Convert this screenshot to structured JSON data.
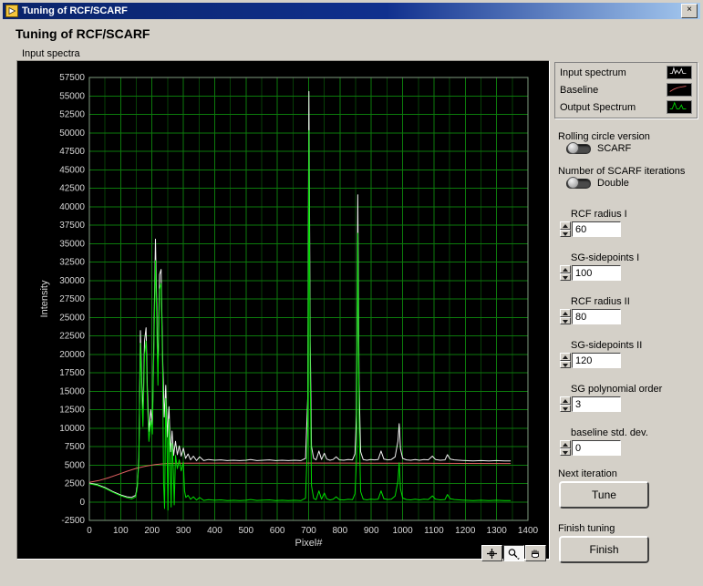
{
  "window": {
    "title": "Tuning of RCF/SCARF",
    "close_glyph": "×"
  },
  "heading": "Tuning of RCF/SCARF",
  "legend": {
    "items": [
      {
        "label": "Input spectrum",
        "color": "#f2f2f2"
      },
      {
        "label": "Baseline",
        "color": "#e06060"
      },
      {
        "label": "Output Spectrum",
        "color": "#00dc00"
      }
    ]
  },
  "controls": {
    "rolling": {
      "label": "Rolling circle version",
      "value": "SCARF"
    },
    "iterations": {
      "label": "Number of SCARF iterations",
      "value": "Double"
    },
    "numerics": [
      {
        "label": "RCF radius I",
        "value": "60"
      },
      {
        "label": "SG-sidepoints I",
        "value": "100"
      },
      {
        "label": "RCF radius II",
        "value": "80"
      },
      {
        "label": "SG-sidepoints II",
        "value": "120"
      },
      {
        "label": "SG polynomial order",
        "value": "3"
      },
      {
        "label": "baseline std. dev.",
        "value": "0"
      }
    ],
    "next_iteration": {
      "label": "Next iteration",
      "button": "Tune"
    },
    "finish": {
      "label": "Finish tuning",
      "button": "Finish"
    }
  },
  "palette": {
    "tools": [
      "cursor-tool",
      "zoom-tool",
      "pan-tool"
    ],
    "active": "zoom-tool"
  },
  "chart_data": {
    "type": "line",
    "title": "Input spectra",
    "xlabel": "Pixel#",
    "ylabel": "Intensity",
    "xlim": [
      0,
      1400
    ],
    "ylim": [
      -2500,
      57500
    ],
    "x_ticks": [
      0,
      100,
      200,
      300,
      400,
      500,
      600,
      700,
      800,
      900,
      1000,
      1100,
      1200,
      1300,
      1400
    ],
    "y_ticks": [
      57500,
      55000,
      52500,
      50000,
      47500,
      45000,
      42500,
      40000,
      37500,
      35000,
      32500,
      30000,
      27500,
      25000,
      22500,
      20000,
      17500,
      15000,
      12500,
      10000,
      7500,
      5000,
      2500,
      0,
      -2500
    ],
    "x_minor_step": 50,
    "bg_color": "#000000",
    "grid_major_color": "#0c7a0c",
    "grid_minor_color": "#063f06",
    "frame_color": "#7f9b7f",
    "tick_text_color": "#d8d8d8",
    "legend_position": "top-right-outside",
    "grid": true,
    "series": [
      {
        "name": "Baseline",
        "color": "#e06060",
        "points": [
          [
            0,
            2650
          ],
          [
            30,
            2900
          ],
          [
            60,
            3250
          ],
          [
            90,
            3700
          ],
          [
            120,
            4150
          ],
          [
            150,
            4550
          ],
          [
            180,
            4850
          ],
          [
            210,
            5050
          ],
          [
            240,
            5180
          ],
          [
            270,
            5230
          ],
          [
            300,
            5250
          ],
          [
            450,
            5260
          ],
          [
            600,
            5260
          ],
          [
            750,
            5260
          ],
          [
            900,
            5250
          ],
          [
            1050,
            5240
          ],
          [
            1200,
            5220
          ],
          [
            1345,
            5200
          ]
        ]
      },
      {
        "name": "Input spectrum",
        "color": "#f2f2f2",
        "points": [
          [
            0,
            2550
          ],
          [
            25,
            2350
          ],
          [
            50,
            1950
          ],
          [
            75,
            1400
          ],
          [
            100,
            950
          ],
          [
            120,
            700
          ],
          [
            135,
            620
          ],
          [
            148,
            900
          ],
          [
            153,
            2200
          ],
          [
            158,
            6000
          ],
          [
            163,
            23200
          ],
          [
            167,
            16500
          ],
          [
            171,
            11500
          ],
          [
            176,
            21800
          ],
          [
            181,
            23600
          ],
          [
            185,
            15500
          ],
          [
            190,
            9500
          ],
          [
            196,
            12500
          ],
          [
            201,
            10500
          ],
          [
            206,
            22500
          ],
          [
            211,
            35600
          ],
          [
            215,
            26500
          ],
          [
            219,
            17500
          ],
          [
            224,
            30800
          ],
          [
            229,
            31500
          ],
          [
            234,
            19500
          ],
          [
            239,
            11500
          ],
          [
            244,
            15800
          ],
          [
            249,
            8800
          ],
          [
            254,
            12900
          ],
          [
            259,
            6800
          ],
          [
            264,
            9600
          ],
          [
            269,
            6300
          ],
          [
            275,
            8200
          ],
          [
            281,
            6400
          ],
          [
            287,
            7600
          ],
          [
            293,
            6200
          ],
          [
            300,
            7300
          ],
          [
            307,
            5900
          ],
          [
            315,
            6500
          ],
          [
            323,
            5700
          ],
          [
            332,
            6200
          ],
          [
            342,
            5600
          ],
          [
            352,
            6100
          ],
          [
            365,
            5600
          ],
          [
            380,
            5750
          ],
          [
            400,
            5650
          ],
          [
            420,
            5700
          ],
          [
            440,
            5600
          ],
          [
            460,
            5650
          ],
          [
            480,
            5600
          ],
          [
            500,
            5650
          ],
          [
            515,
            5750
          ],
          [
            535,
            5600
          ],
          [
            555,
            5650
          ],
          [
            575,
            5700
          ],
          [
            595,
            5600
          ],
          [
            615,
            5650
          ],
          [
            635,
            5600
          ],
          [
            655,
            5650
          ],
          [
            675,
            5600
          ],
          [
            690,
            5900
          ],
          [
            697,
            14000
          ],
          [
            701,
            55600
          ],
          [
            705,
            22000
          ],
          [
            709,
            7500
          ],
          [
            716,
            5900
          ],
          [
            724,
            5700
          ],
          [
            733,
            6900
          ],
          [
            741,
            5750
          ],
          [
            750,
            6600
          ],
          [
            758,
            5800
          ],
          [
            768,
            5650
          ],
          [
            778,
            5750
          ],
          [
            788,
            6100
          ],
          [
            798,
            5700
          ],
          [
            812,
            5650
          ],
          [
            826,
            5750
          ],
          [
            840,
            5700
          ],
          [
            848,
            6500
          ],
          [
            853,
            12000
          ],
          [
            857,
            41600
          ],
          [
            861,
            16000
          ],
          [
            866,
            6800
          ],
          [
            874,
            5750
          ],
          [
            886,
            5650
          ],
          [
            898,
            5750
          ],
          [
            910,
            5700
          ],
          [
            922,
            5750
          ],
          [
            931,
            6900
          ],
          [
            940,
            5800
          ],
          [
            952,
            5700
          ],
          [
            964,
            5750
          ],
          [
            976,
            6100
          ],
          [
            985,
            8200
          ],
          [
            989,
            10600
          ],
          [
            993,
            7200
          ],
          [
            1000,
            5900
          ],
          [
            1012,
            5700
          ],
          [
            1026,
            5650
          ],
          [
            1040,
            5750
          ],
          [
            1054,
            5650
          ],
          [
            1068,
            5750
          ],
          [
            1082,
            5700
          ],
          [
            1095,
            6200
          ],
          [
            1105,
            5750
          ],
          [
            1120,
            5650
          ],
          [
            1135,
            5700
          ],
          [
            1143,
            6400
          ],
          [
            1152,
            5800
          ],
          [
            1165,
            5700
          ],
          [
            1180,
            5650
          ],
          [
            1200,
            5600
          ],
          [
            1225,
            5550
          ],
          [
            1250,
            5600
          ],
          [
            1275,
            5550
          ],
          [
            1300,
            5600
          ],
          [
            1325,
            5550
          ],
          [
            1345,
            5550
          ]
        ]
      },
      {
        "name": "Output Spectrum",
        "color": "#00dc00",
        "points": [
          [
            0,
            2450
          ],
          [
            25,
            2250
          ],
          [
            50,
            1850
          ],
          [
            75,
            1300
          ],
          [
            100,
            850
          ],
          [
            120,
            560
          ],
          [
            135,
            400
          ],
          [
            148,
            680
          ],
          [
            153,
            1900
          ],
          [
            158,
            5400
          ],
          [
            163,
            21500
          ],
          [
            167,
            15000
          ],
          [
            171,
            10200
          ],
          [
            176,
            20000
          ],
          [
            181,
            21800
          ],
          [
            185,
            13800
          ],
          [
            190,
            8200
          ],
          [
            196,
            11000
          ],
          [
            201,
            9200
          ],
          [
            206,
            20800
          ],
          [
            211,
            32700
          ],
          [
            215,
            24500
          ],
          [
            219,
            15800
          ],
          [
            224,
            28800
          ],
          [
            229,
            29600
          ],
          [
            234,
            17800
          ],
          [
            237,
            2600
          ],
          [
            240,
            -900
          ],
          [
            244,
            14000
          ],
          [
            248,
            7200
          ],
          [
            251,
            -1100
          ],
          [
            254,
            11200
          ],
          [
            258,
            5200
          ],
          [
            261,
            -700
          ],
          [
            264,
            7900
          ],
          [
            268,
            4400
          ],
          [
            271,
            -400
          ],
          [
            275,
            6300
          ],
          [
            281,
            4500
          ],
          [
            287,
            5700
          ],
          [
            293,
            4200
          ],
          [
            300,
            5400
          ],
          [
            304,
            1500
          ],
          [
            308,
            600
          ],
          [
            315,
            900
          ],
          [
            323,
            350
          ],
          [
            332,
            700
          ],
          [
            342,
            250
          ],
          [
            352,
            600
          ],
          [
            365,
            200
          ],
          [
            380,
            300
          ],
          [
            400,
            230
          ],
          [
            420,
            280
          ],
          [
            440,
            180
          ],
          [
            460,
            230
          ],
          [
            480,
            180
          ],
          [
            500,
            230
          ],
          [
            515,
            330
          ],
          [
            535,
            200
          ],
          [
            555,
            240
          ],
          [
            575,
            280
          ],
          [
            595,
            180
          ],
          [
            615,
            230
          ],
          [
            635,
            180
          ],
          [
            655,
            230
          ],
          [
            675,
            180
          ],
          [
            690,
            500
          ],
          [
            697,
            9000
          ],
          [
            701,
            50300
          ],
          [
            705,
            17000
          ],
          [
            709,
            2200
          ],
          [
            716,
            480
          ],
          [
            724,
            300
          ],
          [
            733,
            1500
          ],
          [
            741,
            380
          ],
          [
            750,
            1200
          ],
          [
            758,
            420
          ],
          [
            768,
            270
          ],
          [
            778,
            350
          ],
          [
            788,
            700
          ],
          [
            798,
            320
          ],
          [
            812,
            270
          ],
          [
            826,
            350
          ],
          [
            840,
            300
          ],
          [
            848,
            1100
          ],
          [
            853,
            6000
          ],
          [
            857,
            36400
          ],
          [
            861,
            11000
          ],
          [
            866,
            1400
          ],
          [
            874,
            380
          ],
          [
            886,
            280
          ],
          [
            898,
            380
          ],
          [
            910,
            330
          ],
          [
            922,
            380
          ],
          [
            931,
            1500
          ],
          [
            940,
            420
          ],
          [
            952,
            330
          ],
          [
            964,
            380
          ],
          [
            976,
            800
          ],
          [
            985,
            2800
          ],
          [
            989,
            5300
          ],
          [
            993,
            1800
          ],
          [
            1000,
            520
          ],
          [
            1012,
            330
          ],
          [
            1026,
            280
          ],
          [
            1040,
            380
          ],
          [
            1054,
            280
          ],
          [
            1068,
            380
          ],
          [
            1082,
            330
          ],
          [
            1095,
            820
          ],
          [
            1105,
            380
          ],
          [
            1120,
            280
          ],
          [
            1135,
            330
          ],
          [
            1143,
            1000
          ],
          [
            1152,
            420
          ],
          [
            1165,
            330
          ],
          [
            1180,
            280
          ],
          [
            1200,
            230
          ],
          [
            1225,
            180
          ],
          [
            1250,
            230
          ],
          [
            1275,
            180
          ],
          [
            1300,
            230
          ],
          [
            1325,
            180
          ],
          [
            1345,
            180
          ]
        ]
      }
    ]
  }
}
